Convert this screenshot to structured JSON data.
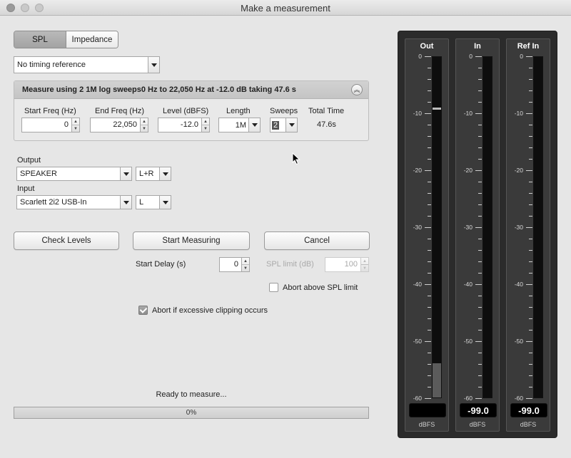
{
  "window": {
    "title": "Make a measurement"
  },
  "mode_tabs": {
    "spl": "SPL",
    "impedance": "Impedance"
  },
  "timing_reference": {
    "value": "No timing reference"
  },
  "sweep_panel": {
    "title": "Measure using 2 1M log sweeps0 Hz to 22,050 Hz at -12.0 dB taking 47.6 s",
    "collapse_symbol": "︽",
    "labels": {
      "start_freq": "Start Freq (Hz)",
      "end_freq": "End Freq (Hz)",
      "level": "Level (dBFS)",
      "length": "Length",
      "sweeps": "Sweeps",
      "total_time": "Total Time"
    },
    "values": {
      "start_freq": "0",
      "end_freq": "22,050",
      "level": "-12.0",
      "length": "1M",
      "sweeps": "2",
      "total_time": "47.6s"
    }
  },
  "output": {
    "label": "Output",
    "device": "SPEAKER",
    "channel": "L+R"
  },
  "input": {
    "label": "Input",
    "device": "Scarlett 2i2 USB-In",
    "channel": "L"
  },
  "buttons": {
    "check_levels": "Check Levels",
    "start_measuring": "Start Measuring",
    "cancel": "Cancel"
  },
  "start_delay": {
    "label": "Start Delay (s)",
    "value": "0"
  },
  "spl_limit": {
    "label": "SPL limit (dB)",
    "value": "100"
  },
  "abort_spl": {
    "label": "Abort above SPL limit",
    "checked": false
  },
  "abort_clipping": {
    "label": "Abort if excessive clipping occurs",
    "checked": true
  },
  "status": {
    "text": "Ready to measure..."
  },
  "progress": {
    "value": 0,
    "text": "0%"
  },
  "meters": {
    "scale": [
      "0",
      "-10",
      "-20",
      "-30",
      "-40",
      "-50",
      "-60"
    ],
    "unit": "dBFS",
    "channels": [
      {
        "name": "Out",
        "readout": "",
        "level_db": -54,
        "peak_db": -9
      },
      {
        "name": "In",
        "readout": "-99.0",
        "level_db": -99,
        "peak_db": null
      },
      {
        "name": "Ref In",
        "readout": "-99.0",
        "level_db": -99,
        "peak_db": null
      }
    ]
  }
}
